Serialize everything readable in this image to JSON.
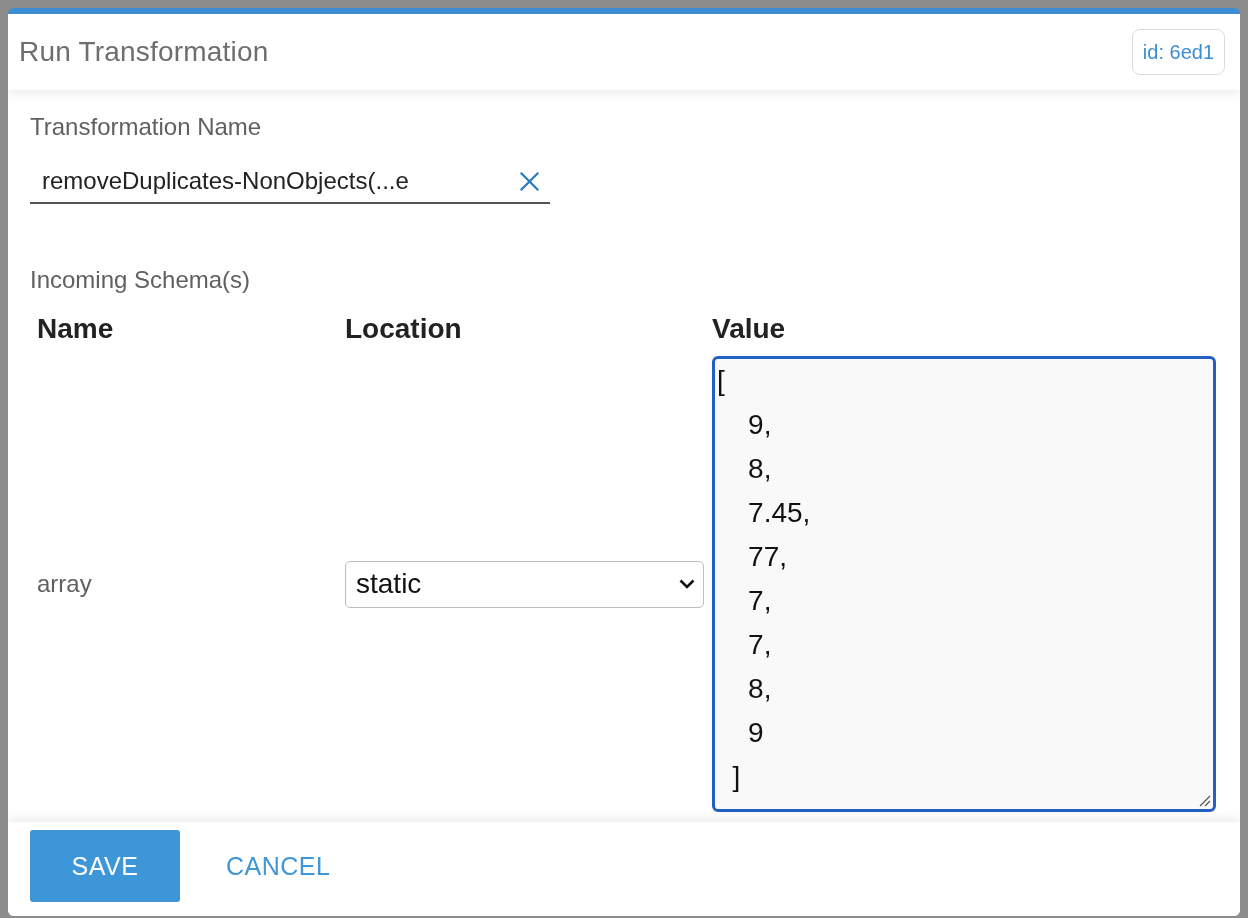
{
  "dialog": {
    "title": "Run Transformation",
    "id_badge": "id: 6ed1"
  },
  "transformation_name": {
    "label": "Transformation Name",
    "value": "removeDuplicates-NonObjects(...e"
  },
  "incoming_schemas": {
    "label": "Incoming Schema(s)",
    "columns": [
      "Name",
      "Location",
      "Value"
    ],
    "rows": [
      {
        "name": "array",
        "location": "static",
        "value": "[\n    9,\n    8,\n    7.45,\n    77,\n    7,\n    7,\n    8,\n    9\n  ]",
        "focused": true
      }
    ]
  },
  "buttons": [
    {
      "label": "SAVE",
      "kind": "primary"
    },
    {
      "label": "CANCEL",
      "kind": "text"
    }
  ]
}
